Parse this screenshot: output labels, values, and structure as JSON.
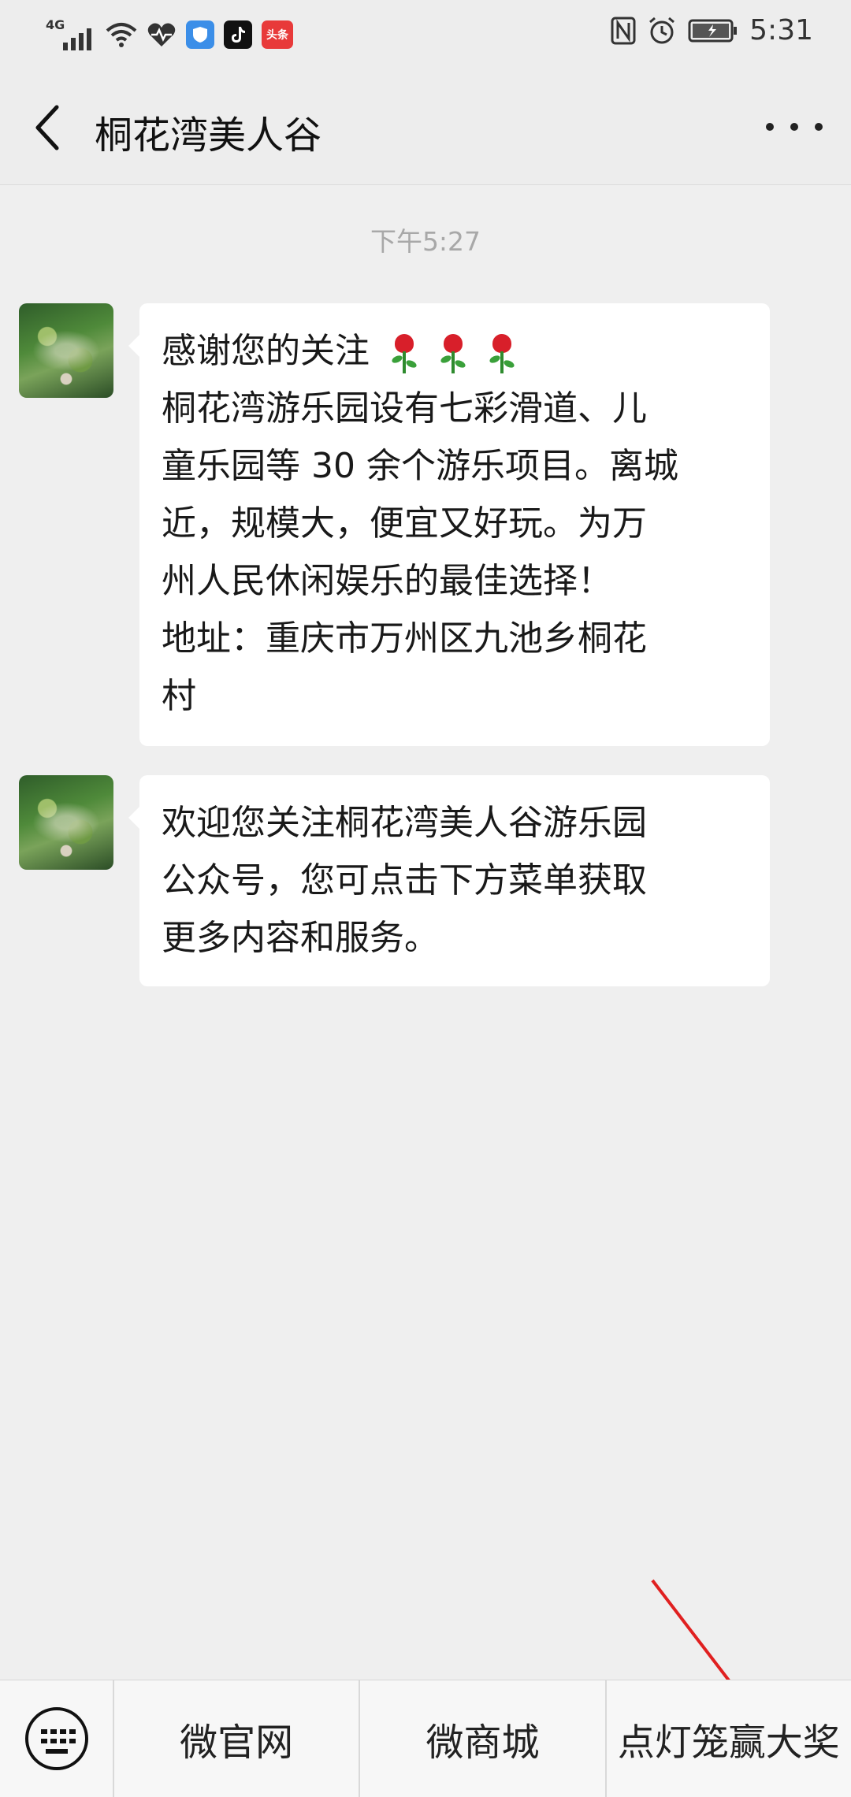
{
  "status_bar": {
    "network": "4G",
    "app_badges": [
      "shield-app",
      "tiktok-app",
      "头条"
    ],
    "time": "5:31"
  },
  "nav": {
    "title": "桐花湾美人谷"
  },
  "chat": {
    "timestamp": "下午5:27",
    "messages": [
      {
        "lines": [
          "感谢您的关注",
          "桐花湾游乐园设有七彩滑道、儿",
          "童乐园等 30 余个游乐项目。离城",
          "近，规模大，便宜又好玩。为万",
          "州人民休闲娱乐的最佳选择！",
          "地址：重庆市万州区九池乡桐花",
          "村"
        ]
      },
      {
        "lines": [
          "欢迎您关注桐花湾美人谷游乐园",
          "公众号，您可点击下方菜单获取",
          "更多内容和服务。"
        ]
      }
    ]
  },
  "bottom_menu": {
    "items": [
      "微官网",
      "微商城",
      "点灯笼赢大奖"
    ]
  },
  "colors": {
    "background": "#efefef",
    "bubble": "#ffffff",
    "annotation_arrow": "#e02020"
  }
}
